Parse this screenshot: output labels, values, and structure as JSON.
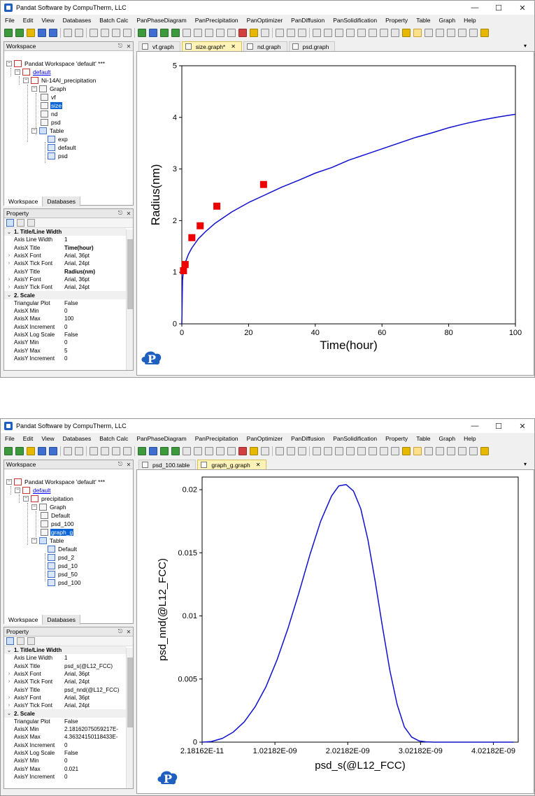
{
  "windows": [
    {
      "title": "Pandat Software by CompuTherm, LLC",
      "menu": [
        "File",
        "Edit",
        "View",
        "Databases",
        "Batch Calc",
        "PanPhaseDiagram",
        "PanPrecipitation",
        "PanOptimizer",
        "PanDiffusion",
        "PanSolidification",
        "Property",
        "Table",
        "Graph",
        "Help"
      ],
      "workspace_title": "Workspace",
      "tree": {
        "root": "Pandat Workspace 'default' ***",
        "db": "default",
        "calc": "Ni-14Al_precipitation",
        "graph_folder": "Graph",
        "graphs": [
          "vf",
          "size",
          "nd",
          "psd"
        ],
        "table_folder": "Table",
        "tables": [
          "exp",
          "default",
          "psd"
        ]
      },
      "bottom_tabs": [
        "Workspace",
        "Databases"
      ],
      "property_title": "Property",
      "properties": {
        "cat1": "1. Title/Line Width",
        "rows1": [
          {
            "k": "Axis Line Width",
            "v": "1"
          },
          {
            "k": "AxisX Title",
            "v": "Time(hour)"
          },
          {
            "k": "AxisX Font",
            "v": "Arial, 36pt"
          },
          {
            "k": "AxisX Tick Font",
            "v": "Arial, 24pt"
          },
          {
            "k": "AxisY Title",
            "v": "Radius(nm)"
          },
          {
            "k": "AxisY Font",
            "v": "Arial, 36pt"
          },
          {
            "k": "AxisY Tick Font",
            "v": "Arial, 24pt"
          }
        ],
        "cat2": "2. Scale",
        "rows2": [
          {
            "k": "Triangular Plot",
            "v": "False"
          },
          {
            "k": "AxisX Min",
            "v": "0"
          },
          {
            "k": "AxisX Max",
            "v": "100"
          },
          {
            "k": "AxisX Increment",
            "v": "0"
          },
          {
            "k": "AxisX Log Scale",
            "v": "False"
          },
          {
            "k": "AxisY Min",
            "v": "0"
          },
          {
            "k": "AxisY Max",
            "v": "5"
          },
          {
            "k": "AxisY Increment",
            "v": "0"
          }
        ]
      },
      "doc_tabs": [
        {
          "label": "vf.graph",
          "active": false
        },
        {
          "label": "size.graph*",
          "active": true
        },
        {
          "label": "nd.graph",
          "active": false
        },
        {
          "label": "psd.graph",
          "active": false
        }
      ]
    },
    {
      "title": "Pandat Software by CompuTherm, LLC",
      "menu": [
        "File",
        "Edit",
        "View",
        "Databases",
        "Batch Calc",
        "PanPhaseDiagram",
        "PanPrecipitation",
        "PanOptimizer",
        "PanDiffusion",
        "PanSolidification",
        "Property",
        "Table",
        "Graph",
        "Help"
      ],
      "workspace_title": "Workspace",
      "tree": {
        "root": "Pandat Workspace 'default' ***",
        "db": "default",
        "calc": "precipitation",
        "graph_folder": "Graph",
        "graphs": [
          "Default",
          "psd_100",
          "graph_g"
        ],
        "table_folder": "Table",
        "tables": [
          "Default",
          "psd_2",
          "psd_10",
          "psd_50",
          "psd_100"
        ]
      },
      "bottom_tabs": [
        "Workspace",
        "Databases"
      ],
      "property_title": "Property",
      "properties": {
        "cat1": "1. Title/Line Width",
        "rows1": [
          {
            "k": "Axis Line Width",
            "v": "1"
          },
          {
            "k": "AxisX Title",
            "v": "psd_s(@L12_FCC)"
          },
          {
            "k": "AxisX Font",
            "v": "Arial, 36pt"
          },
          {
            "k": "AxisX Tick Font",
            "v": "Arial, 24pt"
          },
          {
            "k": "AxisY Title",
            "v": "psd_nnd(@L12_FCC)"
          },
          {
            "k": "AxisY Font",
            "v": "Arial, 36pt"
          },
          {
            "k": "AxisY Tick Font",
            "v": "Arial, 24pt"
          }
        ],
        "cat2": "2. Scale",
        "rows2": [
          {
            "k": "Triangular Plot",
            "v": "False"
          },
          {
            "k": "AxisX Min",
            "v": "2.18162075059217E-"
          },
          {
            "k": "AxisX Max",
            "v": "4.36324150118433E-"
          },
          {
            "k": "AxisX Increment",
            "v": "0"
          },
          {
            "k": "AxisX Log Scale",
            "v": "False"
          },
          {
            "k": "AxisY Min",
            "v": "0"
          },
          {
            "k": "AxisY Max",
            "v": "0.021"
          },
          {
            "k": "AxisY Increment",
            "v": "0"
          }
        ]
      },
      "doc_tabs": [
        {
          "label": "psd_100.table",
          "active": false
        },
        {
          "label": "graph_g.graph",
          "active": true
        }
      ]
    }
  ],
  "colors": {
    "line": "#1010d0",
    "marker": "#ee0000",
    "selected": "#0a64d8"
  },
  "chart_data": [
    {
      "type": "line",
      "xlabel": "Time(hour)",
      "ylabel": "Radius(nm)",
      "xlim": [
        0,
        100
      ],
      "ylim": [
        0,
        5
      ],
      "xticks": [
        0,
        20,
        40,
        60,
        80,
        100
      ],
      "yticks": [
        0,
        1,
        2,
        3,
        4,
        5
      ],
      "grid": false,
      "series": [
        {
          "style": "line",
          "x": [
            0,
            0.2,
            0.5,
            1,
            2,
            3,
            5,
            7,
            10,
            15,
            20,
            25,
            30,
            35,
            40,
            45,
            50,
            55,
            60,
            65,
            70,
            75,
            80,
            85,
            90,
            95,
            100
          ],
          "y": [
            0,
            0.85,
            1.05,
            1.18,
            1.35,
            1.47,
            1.65,
            1.78,
            1.95,
            2.17,
            2.35,
            2.5,
            2.65,
            2.78,
            2.92,
            3.03,
            3.17,
            3.28,
            3.39,
            3.5,
            3.61,
            3.7,
            3.8,
            3.88,
            3.95,
            4.01,
            4.06
          ]
        },
        {
          "style": "marker",
          "x": [
            0.5,
            1,
            3,
            5.5,
            10.5,
            24.5
          ],
          "y": [
            1.03,
            1.15,
            1.67,
            1.9,
            2.28,
            2.7
          ]
        }
      ]
    },
    {
      "type": "line",
      "xlabel": "psd_s(@L12_FCC)",
      "ylabel": "psd_nnd(@L12_FCC)",
      "xlim": [
        2.18162e-11,
        4.36324e-09
      ],
      "ylim": [
        0,
        0.021
      ],
      "xtick_labels": [
        "2.18162E-11",
        "1.02182E-09",
        "2.02182E-09",
        "3.02182E-09",
        "4.02182E-09"
      ],
      "xticks": [
        2.18162e-11,
        1.02182e-09,
        2.02182e-09,
        3.02182e-09,
        4.02182e-09
      ],
      "yticks": [
        0,
        0.005,
        0.01,
        0.015,
        0.02
      ],
      "ytick_labels": [
        "0",
        "0.005",
        "0.01",
        "0.015",
        "0.02"
      ],
      "grid": false,
      "series": [
        {
          "style": "line",
          "x": [
            2.18e-11,
            1.5e-10,
            3e-10,
            4.5e-10,
            6e-10,
            7.5e-10,
            9e-10,
            1.05e-09,
            1.2e-09,
            1.35e-09,
            1.5e-09,
            1.65e-09,
            1.8e-09,
            1.9e-09,
            2e-09,
            2.1e-09,
            2.2e-09,
            2.3e-09,
            2.4e-09,
            2.5e-09,
            2.6e-09,
            2.7e-09,
            2.8e-09,
            2.9e-09,
            3e-09,
            3.1e-09,
            3.2e-09,
            3.5e-09,
            4.3e-09
          ],
          "y": [
            0,
            5e-05,
            0.0003,
            0.0008,
            0.0016,
            0.0028,
            0.0044,
            0.0065,
            0.009,
            0.0118,
            0.0148,
            0.0175,
            0.0195,
            0.0203,
            0.0204,
            0.0199,
            0.0185,
            0.016,
            0.0127,
            0.0091,
            0.0057,
            0.003,
            0.0012,
            0.0004,
            0.0001,
            2e-05,
            0,
            0,
            0
          ]
        }
      ]
    }
  ]
}
